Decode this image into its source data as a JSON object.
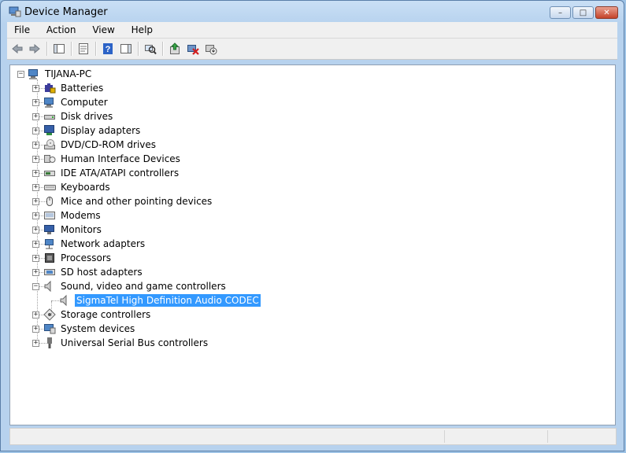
{
  "window": {
    "title": "Device Manager"
  },
  "window_controls": {
    "minimize": "–",
    "maximize": "□",
    "close": "✕"
  },
  "menu": [
    {
      "label": "File"
    },
    {
      "label": "Action"
    },
    {
      "label": "View"
    },
    {
      "label": "Help"
    }
  ],
  "toolbar": {
    "buttons": [
      {
        "icon": "back-arrow-icon"
      },
      {
        "icon": "forward-arrow-icon"
      },
      {
        "icon": "show-hide-console-tree-icon"
      },
      {
        "icon": "properties-icon"
      },
      {
        "icon": "help-icon"
      },
      {
        "icon": "show-hide-action-pane-icon"
      },
      {
        "icon": "scan-hardware-changes-icon"
      },
      {
        "icon": "update-driver-icon"
      },
      {
        "icon": "uninstall-icon"
      },
      {
        "icon": "disable-device-icon"
      }
    ]
  },
  "tree": {
    "root": "TIJANA-PC",
    "categories": [
      {
        "label": "Batteries",
        "icon": "battery-icon",
        "expanded": false
      },
      {
        "label": "Computer",
        "icon": "computer-icon",
        "expanded": false
      },
      {
        "label": "Disk drives",
        "icon": "disk-drive-icon",
        "expanded": false
      },
      {
        "label": "Display adapters",
        "icon": "display-adapter-icon",
        "expanded": false
      },
      {
        "label": "DVD/CD-ROM drives",
        "icon": "dvd-drive-icon",
        "expanded": false
      },
      {
        "label": "Human Interface Devices",
        "icon": "hid-icon",
        "expanded": false
      },
      {
        "label": "IDE ATA/ATAPI controllers",
        "icon": "ide-controller-icon",
        "expanded": false
      },
      {
        "label": "Keyboards",
        "icon": "keyboard-icon",
        "expanded": false
      },
      {
        "label": "Mice and other pointing devices",
        "icon": "mouse-icon",
        "expanded": false
      },
      {
        "label": "Modems",
        "icon": "modem-icon",
        "expanded": false
      },
      {
        "label": "Monitors",
        "icon": "monitor-icon",
        "expanded": false
      },
      {
        "label": "Network adapters",
        "icon": "network-adapter-icon",
        "expanded": false
      },
      {
        "label": "Processors",
        "icon": "processor-icon",
        "expanded": false
      },
      {
        "label": "SD host adapters",
        "icon": "sd-host-icon",
        "expanded": false
      },
      {
        "label": "Sound, video and game controllers",
        "icon": "speaker-icon",
        "expanded": true,
        "children": [
          {
            "label": "SigmaTel High Definition Audio CODEC",
            "icon": "speaker-icon",
            "selected": true
          }
        ]
      },
      {
        "label": "Storage controllers",
        "icon": "storage-controller-icon",
        "expanded": false
      },
      {
        "label": "System devices",
        "icon": "system-devices-icon",
        "expanded": false
      },
      {
        "label": "Universal Serial Bus controllers",
        "icon": "usb-icon",
        "expanded": false
      }
    ]
  },
  "colors": {
    "selection": "#3399ff",
    "titlebar": "#b7d2ee"
  }
}
